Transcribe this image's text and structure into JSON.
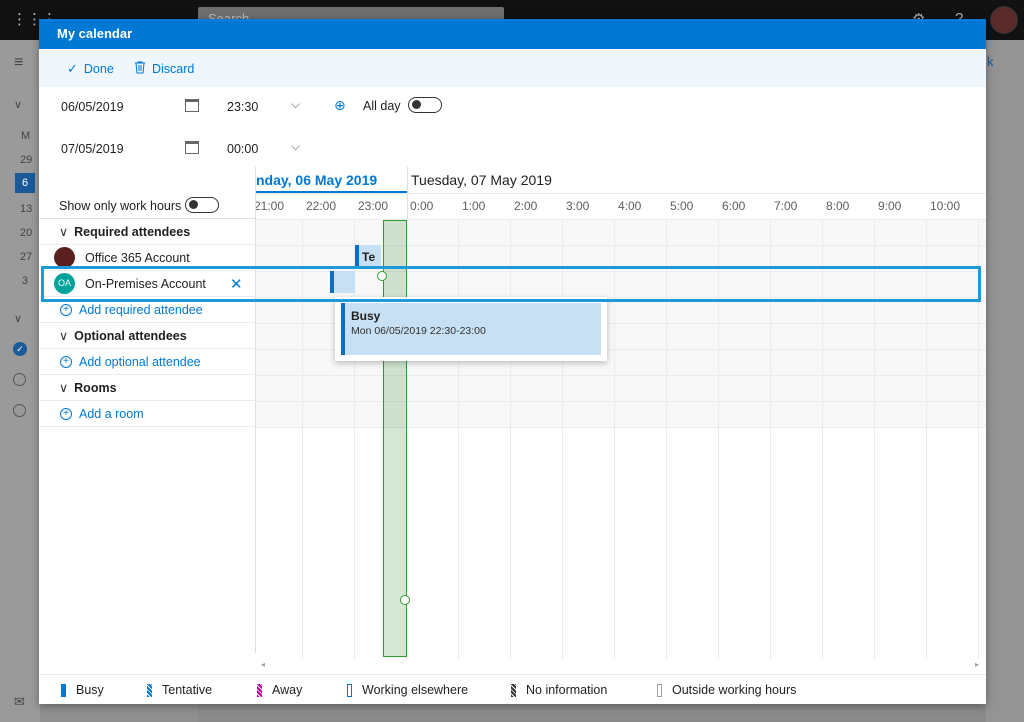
{
  "modal": {
    "title": "My calendar",
    "done_label": "Done",
    "discard_label": "Discard",
    "start_date": "06/05/2019",
    "start_time": "23:30",
    "end_date": "07/05/2019",
    "end_time": "00:00",
    "allday_label": "All day",
    "allday_on": false
  },
  "scheduling": {
    "day1": "nday, 06 May 2019",
    "day2": "Tuesday, 07 May 2019",
    "hours": [
      "21:00",
      "22:00",
      "23:00",
      "0:00",
      "1:00",
      "2:00",
      "3:00",
      "4:00",
      "5:00",
      "6:00",
      "7:00",
      "8:00",
      "9:00",
      "10:00"
    ],
    "work_hours_label": "Show only work hours",
    "required_label": "Required attendees",
    "attendees": [
      {
        "name": "Office 365 Account",
        "avatar": "photo"
      },
      {
        "name": "On-Premises Account",
        "initials": "OA",
        "color": "#00a39b"
      }
    ],
    "add_required": "Add required attendee",
    "optional_label": "Optional attendees",
    "add_optional": "Add optional attendee",
    "rooms_label": "Rooms",
    "add_room": "Add a room",
    "event_short": "Te",
    "popup": {
      "status": "Busy",
      "detail": "Mon 06/05/2019 22:30-23:00"
    }
  },
  "legend": [
    {
      "label": "Busy",
      "color": "#0078d4"
    },
    {
      "label": "Tentative",
      "color": "#0078d4"
    },
    {
      "label": "Away",
      "color": "#b4009e"
    },
    {
      "label": "Working elsewhere",
      "color": "#0078d4"
    },
    {
      "label": "No information",
      "color": "#323130"
    },
    {
      "label": "Outside working hours",
      "color": "#a19f9d"
    }
  ],
  "background": {
    "search_placeholder": "Search",
    "mini_cal": [
      "M",
      "29",
      "6",
      "13",
      "20",
      "27",
      "3"
    ],
    "partial_right": "k"
  }
}
